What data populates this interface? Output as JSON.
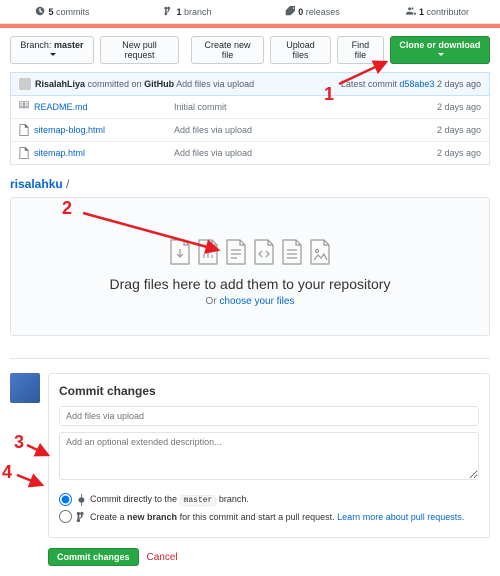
{
  "stats": {
    "commits": "5",
    "commits_lbl": "commits",
    "branches": "1",
    "branches_lbl": "branch",
    "releases": "0",
    "releases_lbl": "releases",
    "contributors": "1",
    "contributors_lbl": "contributor"
  },
  "toolbar": {
    "branch_label": "Branch:",
    "branch": "master",
    "new_pr": "New pull request",
    "create": "Create new file",
    "upload": "Upload files",
    "find": "Find file",
    "clone": "Clone or download"
  },
  "commit_bar": {
    "user": "RisalahLiya",
    "action": "committed on",
    "where": "GitHub",
    "msg": "Add files via upload",
    "latest": "Latest commit",
    "sha": "d58abe3",
    "when": "2 days ago"
  },
  "files": [
    {
      "name": "README.md",
      "msg": "Initial commit",
      "time": "2 days ago",
      "icon": "readme"
    },
    {
      "name": "sitemap-blog.html",
      "msg": "Add files via upload",
      "time": "2 days ago",
      "icon": "file"
    },
    {
      "name": "sitemap.html",
      "msg": "Add files via upload",
      "time": "2 days ago",
      "icon": "file"
    }
  ],
  "crumb": {
    "repo": "risalahku",
    "sep": "/"
  },
  "dropzone": {
    "title": "Drag files here to add them to your repository",
    "or": "Or",
    "choose": "choose your files"
  },
  "commit": {
    "heading": "Commit changes",
    "summary_ph": "Add files via upload",
    "desc_ph": "Add an optional extended description...",
    "opt1a": "Commit directly to the",
    "opt1_branch": "master",
    "opt1b": "branch.",
    "opt2a": "Create a",
    "opt2b": "new branch",
    "opt2c": "for this commit and start a pull request.",
    "opt2_link": "Learn more about pull requests.",
    "submit": "Commit changes",
    "cancel": "Cancel"
  },
  "annotations": {
    "n1": "1",
    "n2": "2",
    "n3": "3",
    "n4": "4"
  }
}
